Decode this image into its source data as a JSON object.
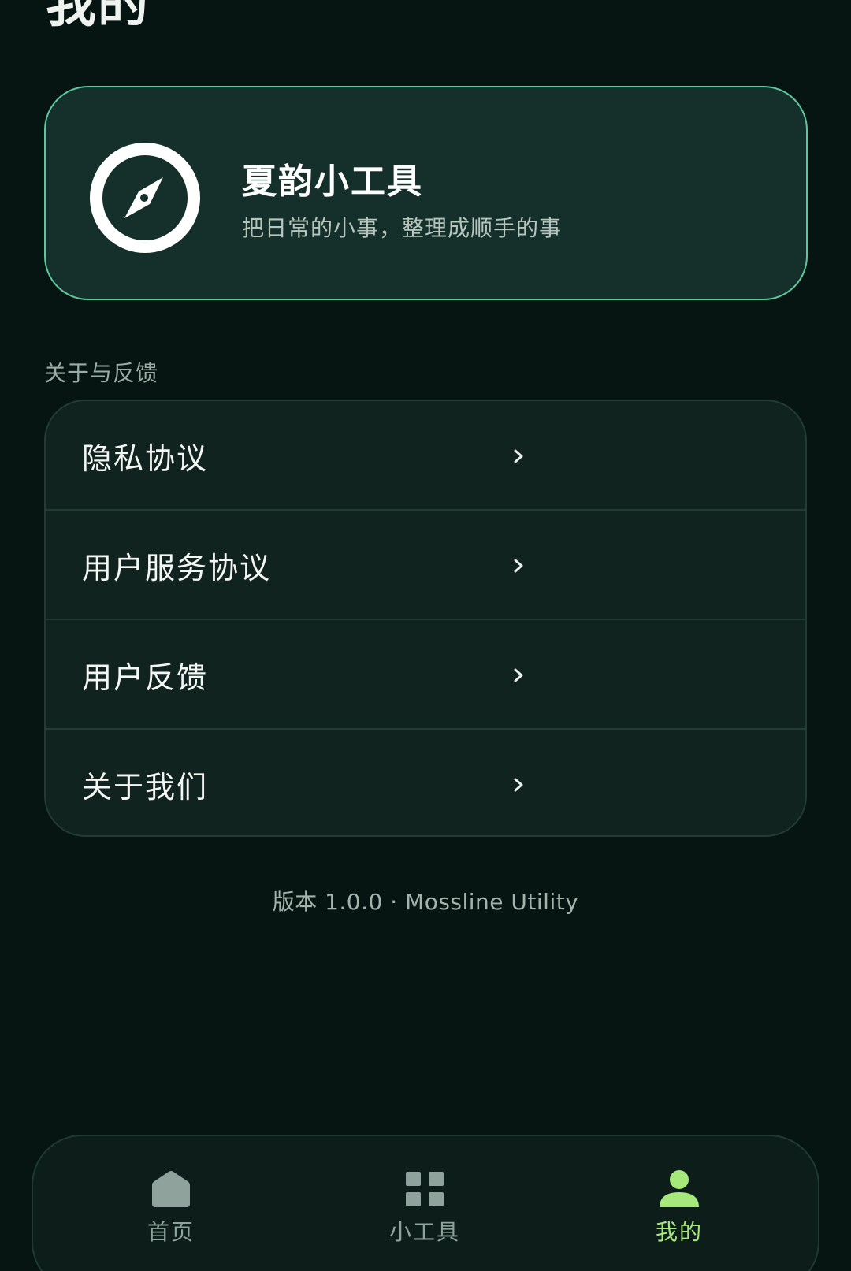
{
  "page": {
    "title": "我的"
  },
  "profile": {
    "icon": "compass-icon",
    "name": "夏韵小工具",
    "tagline": "把日常的小事，整理成顺手的事"
  },
  "section": {
    "label": "关于与反馈"
  },
  "menu": {
    "items": [
      {
        "label": "隐私协议",
        "icon": "chevron-right-icon"
      },
      {
        "label": "用户服务协议",
        "icon": "chevron-right-icon"
      },
      {
        "label": "用户反馈",
        "icon": "chevron-right-icon"
      },
      {
        "label": "关于我们",
        "icon": "chevron-right-icon"
      }
    ]
  },
  "footer": {
    "version": "版本 1.0.0 · Mossline Utility"
  },
  "nav": {
    "tabs": [
      {
        "label": "首页",
        "icon": "home-icon",
        "active": false
      },
      {
        "label": "小工具",
        "icon": "grid-icon",
        "active": false
      },
      {
        "label": "我的",
        "icon": "person-icon",
        "active": true
      }
    ]
  },
  "colors": {
    "background": "#071512",
    "card": "#15302a",
    "card_border": "#5fc79f",
    "accent_active": "#a6e879",
    "inactive": "#8fa39c"
  }
}
